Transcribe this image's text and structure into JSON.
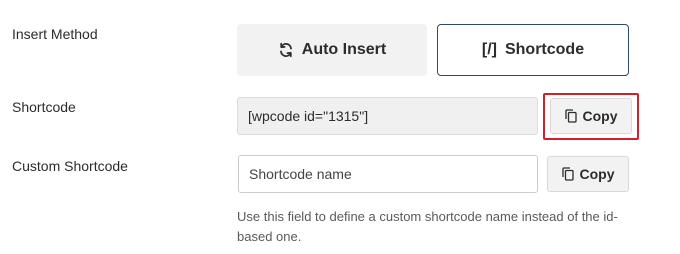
{
  "labels": {
    "insert_method": "Insert Method",
    "shortcode": "Shortcode",
    "custom_shortcode": "Custom Shortcode"
  },
  "insert_method": {
    "options": [
      {
        "label": "Auto Insert",
        "icon": "sync-arrows-icon",
        "selected": false
      },
      {
        "label": "Shortcode",
        "icon": "shortcode-brackets-icon",
        "icon_text": "[/]",
        "selected": true
      }
    ]
  },
  "shortcode": {
    "value": "[wpcode id=\"1315\"]",
    "copy_label": "Copy"
  },
  "custom_shortcode": {
    "placeholder": "Shortcode name",
    "value": "",
    "copy_label": "Copy",
    "help": "Use this field to define a custom shortcode name instead of the id-based one."
  },
  "colors": {
    "selected_border": "#2b4a6e",
    "highlight": "#d0202a",
    "button_bg": "#f2f2f2"
  }
}
